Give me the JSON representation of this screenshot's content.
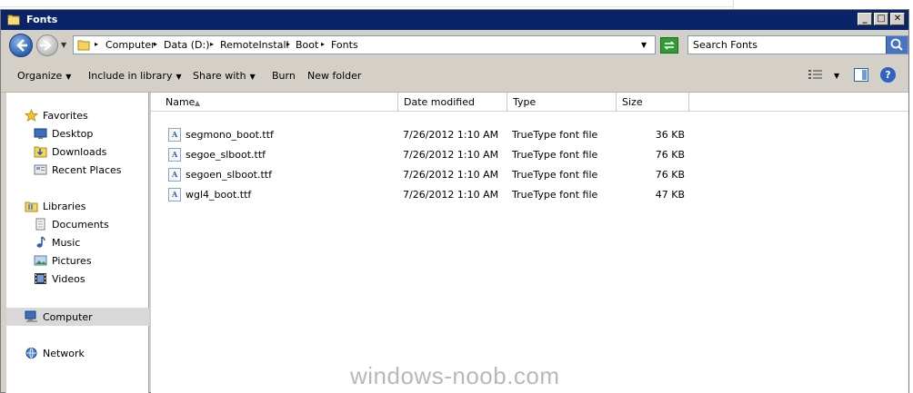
{
  "window": {
    "title": "Fonts",
    "min_glyph": "_",
    "max_glyph": "□",
    "close_glyph": "✕"
  },
  "address": {
    "crumbs": [
      "Computer",
      "Data (D:)",
      "RemoteInstall",
      "Boot",
      "Fonts"
    ],
    "separator": "▸",
    "dropdown": "▼"
  },
  "search": {
    "placeholder": "Search Fonts",
    "icon": "search-icon"
  },
  "toolbar": {
    "organize": "Organize",
    "include_in_library": "Include in library",
    "share_with": "Share with",
    "burn": "Burn",
    "new_folder": "New folder",
    "drop": "▼",
    "help": "?"
  },
  "nav": {
    "favorites": "Favorites",
    "desktop": "Desktop",
    "downloads": "Downloads",
    "recent_places": "Recent Places",
    "libraries": "Libraries",
    "documents": "Documents",
    "music": "Music",
    "pictures": "Pictures",
    "videos": "Videos",
    "computer": "Computer",
    "network": "Network"
  },
  "columns": {
    "name": "Name",
    "date_modified": "Date modified",
    "type": "Type",
    "size": "Size",
    "sort_glyph": "▲"
  },
  "files": [
    {
      "name": "segmono_boot.ttf",
      "date": "7/26/2012 1:10 AM",
      "type": "TrueType font file",
      "size": "36 KB"
    },
    {
      "name": "segoe_slboot.ttf",
      "date": "7/26/2012 1:10 AM",
      "type": "TrueType font file",
      "size": "76 KB"
    },
    {
      "name": "segoen_slboot.ttf",
      "date": "7/26/2012 1:10 AM",
      "type": "TrueType font file",
      "size": "76 KB"
    },
    {
      "name": "wgl4_boot.ttf",
      "date": "7/26/2012 1:10 AM",
      "type": "TrueType font file",
      "size": "47 KB"
    }
  ],
  "file_icon_glyph": "A",
  "watermark": "windows-noob.com",
  "colors": {
    "titlebar": "#0a246a",
    "chrome": "#d4d0c8",
    "selection": "#d9d9d9"
  }
}
